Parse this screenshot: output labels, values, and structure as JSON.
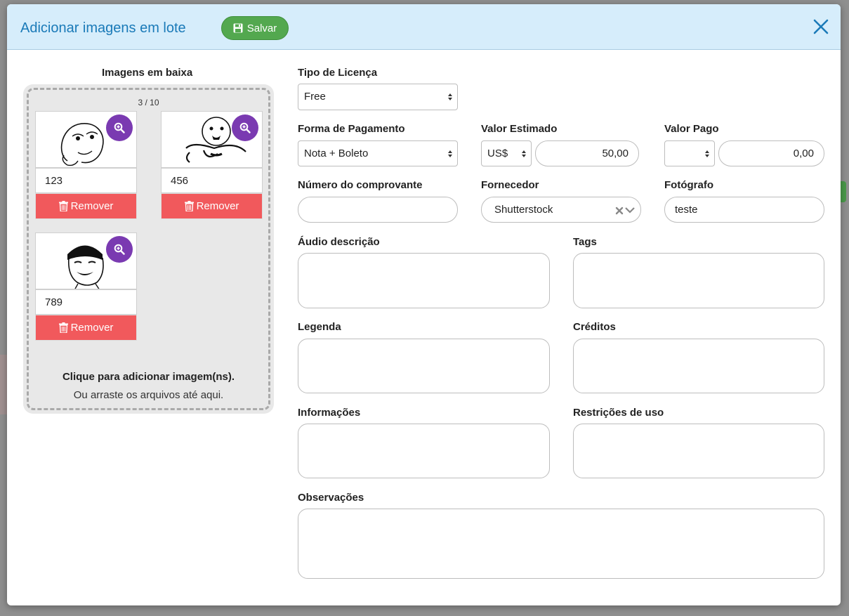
{
  "modal": {
    "title": "Adicionar imagens em lote",
    "save_label": "Salvar"
  },
  "uploads": {
    "section_label": "Imagens em baixa",
    "counter": "3 / 10",
    "images": [
      {
        "name": "123",
        "remove_label": "Remover"
      },
      {
        "name": "456",
        "remove_label": "Remover"
      },
      {
        "name": "789",
        "remove_label": "Remover"
      }
    ],
    "hint_primary": "Clique para adicionar imagem(ns).",
    "hint_secondary": "Ou arraste os arquivos até aqui."
  },
  "form": {
    "license_type": {
      "label": "Tipo de Licença",
      "value": "Free"
    },
    "payment_method": {
      "label": "Forma de Pagamento",
      "value": "Nota + Boleto"
    },
    "estimated_value": {
      "label": "Valor Estimado",
      "currency": "US$",
      "value": "50,00"
    },
    "paid_value": {
      "label": "Valor Pago",
      "currency": "",
      "value": "0,00"
    },
    "receipt_number": {
      "label": "Número do comprovante",
      "value": ""
    },
    "supplier": {
      "label": "Fornecedor",
      "value": "Shutterstock"
    },
    "photographer": {
      "label": "Fotógrafo",
      "value": "teste"
    },
    "audio_description": {
      "label": "Áudio descrição",
      "value": ""
    },
    "tags": {
      "label": "Tags",
      "value": ""
    },
    "caption": {
      "label": "Legenda",
      "value": ""
    },
    "credits": {
      "label": "Créditos",
      "value": ""
    },
    "information": {
      "label": "Informações",
      "value": ""
    },
    "usage_restrictions": {
      "label": "Restrições de uso",
      "value": ""
    },
    "observations": {
      "label": "Observações",
      "value": ""
    }
  },
  "colors": {
    "header_bg": "#d6edfb",
    "title": "#1a7ab8",
    "save": "#53a84f",
    "remove": "#f1595c",
    "zoom": "#7a3ab1"
  },
  "icons": [
    "save-icon",
    "close-icon",
    "zoom-in-icon",
    "trash-icon",
    "select-arrows-icon",
    "clear-icon",
    "chevron-down-icon"
  ]
}
